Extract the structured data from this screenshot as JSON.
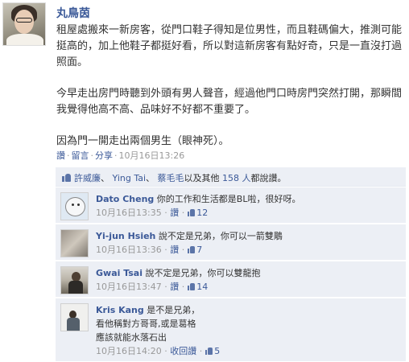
{
  "post": {
    "author": "丸鳥茵",
    "paragraphs": [
      "租屋處搬來一新房客，從門口鞋子得知是位男性，而且鞋碼偏大，推測可能挺高的，加上他鞋子都挺好看，所以對這新房客有點好奇，只是一直沒打過照面。",
      "今早走出房門時聽到外頭有男人聲音，經過他門口時房門突然打開，那瞬間我覺得他高不高、品味好不好都不重要了。",
      "因為門一開走出兩個男生（眼神死）。"
    ],
    "actions": {
      "like": "讚",
      "comment": "留言",
      "share": "分享",
      "timestamp": "10月16日13:26"
    }
  },
  "likes": {
    "names_part1": "許威廉",
    "names_sep1": "、 ",
    "names_part2": "Ying Tai",
    "names_sep2": "、 ",
    "names_part3": "蔡毛毛",
    "middle": "以及其他 ",
    "others": "158 人",
    "suffix": "都說讚。"
  },
  "comments": [
    {
      "name": "Dato Cheng",
      "lines": [
        "你的工作和生活都是BL啦，很好呀。"
      ],
      "timestamp": "10月16日13:35",
      "like": "讚",
      "count": "12"
    },
    {
      "name": "Yi-jun Hsieh",
      "lines": [
        "說不定是兄弟，你可以一箭雙鵰"
      ],
      "timestamp": "10月16日13:36",
      "like": "讚",
      "count": "7"
    },
    {
      "name": "Gwai Tsai",
      "lines": [
        "說不定是兄弟，你可以雙龍抱"
      ],
      "timestamp": "10月16日13:47",
      "like": "讚",
      "count": "14"
    },
    {
      "name": "Kris Kang",
      "lines": [
        "是不是兄弟，",
        "看他稱對方哥哥,或是葛格",
        "應該就能水落石出"
      ],
      "timestamp": "10月16日14:20",
      "like": "收回讚",
      "count": "5"
    }
  ],
  "colors": {
    "link": "#3b5998",
    "comment_bg": "#eceff5",
    "meta": "#999999"
  }
}
